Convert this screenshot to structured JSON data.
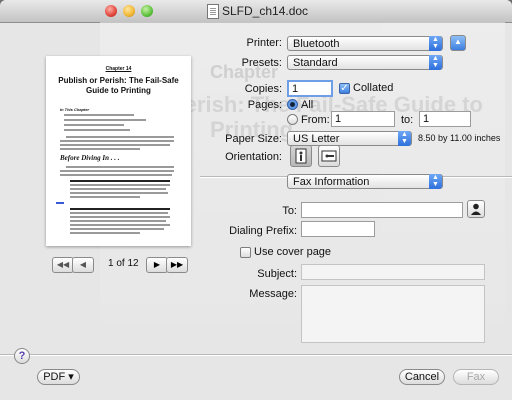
{
  "window": {
    "title": "SLFD_ch14.doc"
  },
  "preview": {
    "chapter": "Chapter 14",
    "title": "Publish or Perish: The Fail-Safe Guide to Printing",
    "in_this_chapter": "In This Chapter",
    "section_heading": "Before Diving In . . .",
    "page_count": "1 of 12",
    "nav": {
      "first": "◀◀",
      "prev": "◀",
      "next": "▶",
      "last": "▶▶"
    }
  },
  "ghost_text": {
    "line1": "Chapter",
    "line2": "Perish: The Fail-Safe Guide to",
    "line3": "Printing"
  },
  "print": {
    "printer": {
      "label": "Printer:",
      "value": "Bluetooth"
    },
    "presets": {
      "label": "Presets:",
      "value": "Standard"
    },
    "copies": {
      "label": "Copies:",
      "value": "1",
      "collated_label": "Collated",
      "collated": true
    },
    "pages": {
      "label": "Pages:",
      "all_label": "All",
      "from_label": "From:",
      "from_value": "1",
      "to_label": "to:",
      "to_value": "1"
    },
    "paper_size": {
      "label": "Paper Size:",
      "value": "US Letter",
      "dimensions": "8.50 by 11.00 inches"
    },
    "orientation": {
      "label": "Orientation:"
    },
    "panel": {
      "value": "Fax Information"
    }
  },
  "fax": {
    "to": {
      "label": "To:",
      "value": ""
    },
    "dialing_prefix": {
      "label": "Dialing Prefix:",
      "value": ""
    },
    "cover_page": {
      "label": "Use cover page",
      "checked": false
    },
    "subject": {
      "label": "Subject:",
      "value": ""
    },
    "message": {
      "label": "Message:",
      "value": ""
    }
  },
  "footer": {
    "help": "?",
    "pdf_label": "PDF ▾",
    "cancel_label": "Cancel",
    "fax_label": "Fax"
  }
}
